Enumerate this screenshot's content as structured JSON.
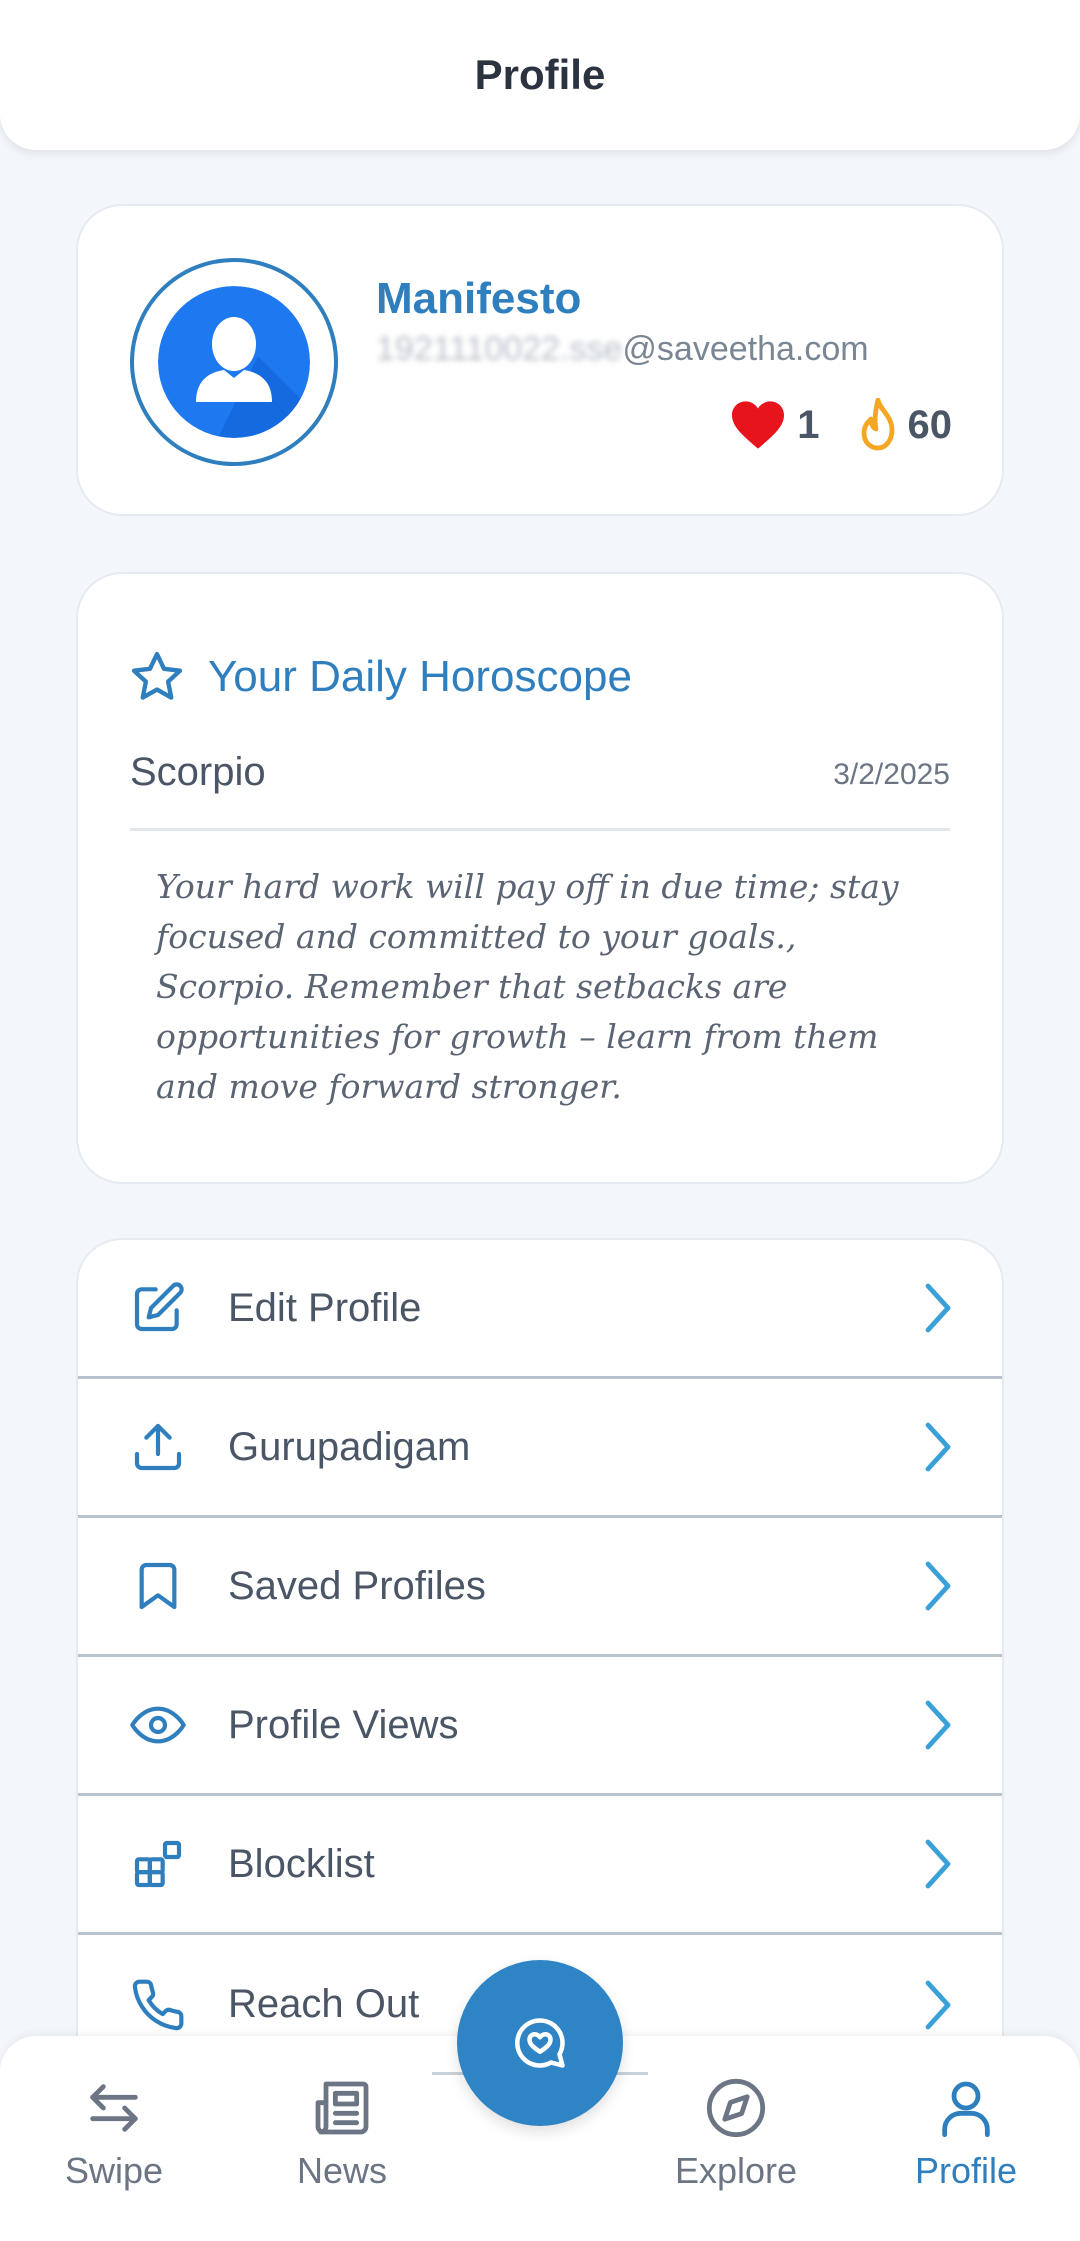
{
  "header": {
    "title": "Profile"
  },
  "profile": {
    "name": "Manifesto",
    "email_masked": "1921110022.sse",
    "email_domain": "@saveetha.com",
    "likes": "1",
    "streak": "60"
  },
  "horoscope": {
    "title": "Your Daily Horoscope",
    "sign": "Scorpio",
    "date": "3/2/2025",
    "text": "Your hard work will pay off in due time; stay focused and committed to your goals., Scorpio. Remember that setbacks are opportunities for growth – learn from them and move forward stronger."
  },
  "menu": {
    "items": [
      {
        "label": "Edit Profile",
        "icon": "edit-icon"
      },
      {
        "label": "Gurupadigam",
        "icon": "upload-icon"
      },
      {
        "label": "Saved Profiles",
        "icon": "bookmark-icon"
      },
      {
        "label": "Profile Views",
        "icon": "eye-icon"
      },
      {
        "label": "Blocklist",
        "icon": "blocks-icon"
      },
      {
        "label": "Reach Out",
        "icon": "phone-icon"
      }
    ]
  },
  "nav": {
    "items": [
      {
        "label": "Swipe",
        "icon": "swap-arrows-icon"
      },
      {
        "label": "News",
        "icon": "newspaper-icon"
      },
      {
        "label": "Explore",
        "icon": "compass-icon"
      },
      {
        "label": "Profile",
        "icon": "user-icon",
        "active": true
      }
    ],
    "fab_icon": "chat-heart-icon"
  },
  "colors": {
    "accent": "#2f7fbf",
    "fab": "#2f84c5",
    "heart": "#e8141c",
    "flame": "#f5a623",
    "background": "#f3f6fa"
  }
}
